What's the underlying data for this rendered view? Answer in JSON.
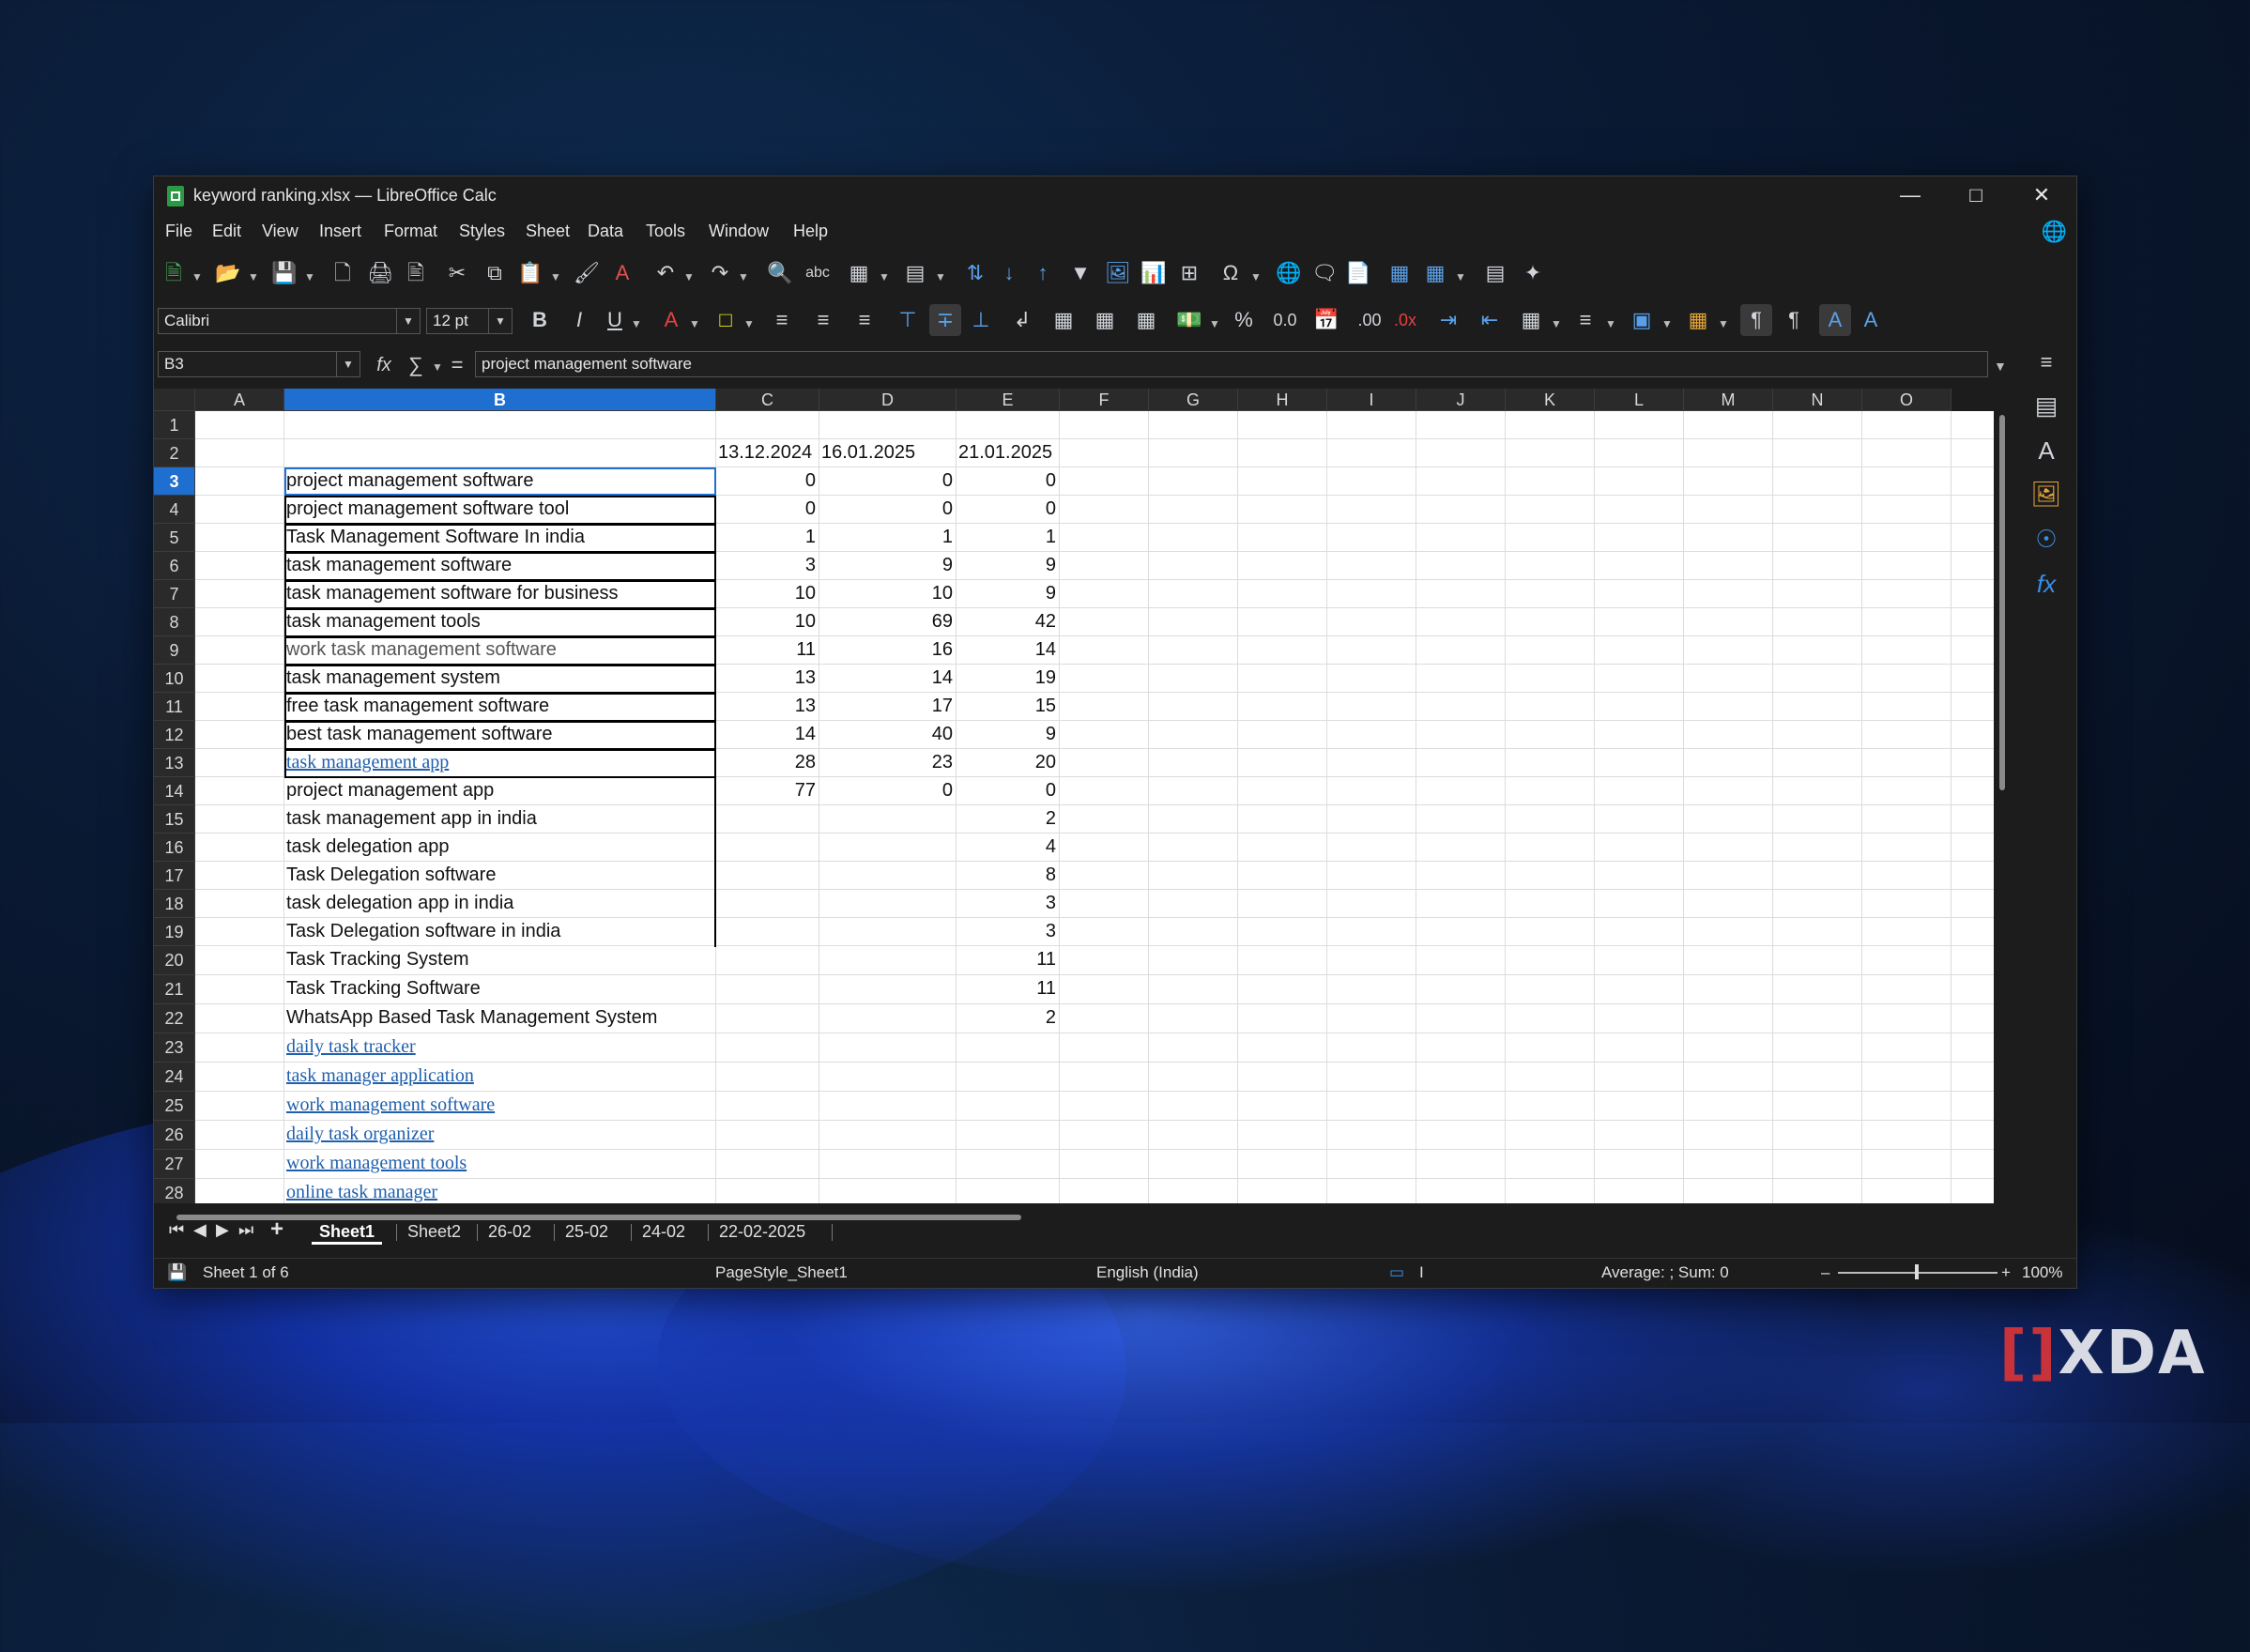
{
  "window": {
    "title": "keyword ranking.xlsx — LibreOffice Calc"
  },
  "menu": [
    "File",
    "Edit",
    "View",
    "Insert",
    "Format",
    "Styles",
    "Sheet",
    "Data",
    "Tools",
    "Window",
    "Help"
  ],
  "format": {
    "font_name": "Calibri",
    "font_size": "12 pt"
  },
  "formula_bar": {
    "cell_ref": "B3",
    "content": "project management software"
  },
  "columns": [
    "A",
    "B",
    "C",
    "D",
    "E",
    "F",
    "G",
    "H",
    "I",
    "J",
    "K",
    "L",
    "M",
    "N",
    "O"
  ],
  "rows": [
    "1",
    "2",
    "3",
    "4",
    "5",
    "6",
    "7",
    "8",
    "9",
    "10",
    "11",
    "12",
    "13",
    "14",
    "15",
    "16",
    "17",
    "18",
    "19",
    "20",
    "21",
    "22",
    "23",
    "24",
    "25",
    "26",
    "27",
    "28"
  ],
  "headers": {
    "c": "13.12.2024",
    "d": "16.01.2025",
    "e": "21.01.2025"
  },
  "data_rows": [
    {
      "keyword": "project management software",
      "c": "0",
      "d": "0",
      "e": "0"
    },
    {
      "keyword": "project management software tool",
      "c": "0",
      "d": "0",
      "e": "0"
    },
    {
      "keyword": "Task Management Software In india",
      "c": "1",
      "d": "1",
      "e": "1"
    },
    {
      "keyword": "task management software",
      "c": "3",
      "d": "9",
      "e": "9"
    },
    {
      "keyword": "task management software for business",
      "c": "10",
      "d": "10",
      "e": "9"
    },
    {
      "keyword": "task management tools",
      "c": "10",
      "d": "69",
      "e": "42"
    },
    {
      "keyword": "work task management software",
      "c": "11",
      "d": "16",
      "e": "14"
    },
    {
      "keyword": "task management system",
      "c": "13",
      "d": "14",
      "e": "19"
    },
    {
      "keyword": "free task management software",
      "c": "13",
      "d": "17",
      "e": "15"
    },
    {
      "keyword": "best task management software",
      "c": "14",
      "d": "40",
      "e": "9"
    },
    {
      "keyword": "task management app",
      "c": "28",
      "d": "23",
      "e": "20"
    },
    {
      "keyword": "project management app",
      "c": "77",
      "d": "0",
      "e": "0"
    },
    {
      "keyword": "task management app in india",
      "c": "",
      "d": "",
      "e": "2"
    },
    {
      "keyword": "task delegation app",
      "c": "",
      "d": "",
      "e": "4"
    },
    {
      "keyword": "Task Delegation software",
      "c": "",
      "d": "",
      "e": "8"
    },
    {
      "keyword": "task delegation app in india",
      "c": "",
      "d": "",
      "e": "3"
    },
    {
      "keyword": "Task Delegation software in india",
      "c": "",
      "d": "",
      "e": "3"
    },
    {
      "keyword": "Task Tracking System",
      "c": "",
      "d": "",
      "e": "11"
    },
    {
      "keyword": "Task Tracking Software",
      "c": "",
      "d": "",
      "e": "11"
    },
    {
      "keyword": "WhatsApp Based Task Management System",
      "c": "",
      "d": "",
      "e": "2"
    },
    {
      "keyword": "daily task tracker",
      "c": "",
      "d": "",
      "e": ""
    },
    {
      "keyword": "task manager application",
      "c": "",
      "d": "",
      "e": ""
    },
    {
      "keyword": "work management software",
      "c": "",
      "d": "",
      "e": ""
    },
    {
      "keyword": "daily task organizer",
      "c": "",
      "d": "",
      "e": ""
    },
    {
      "keyword": "work management tools",
      "c": "",
      "d": "",
      "e": ""
    },
    {
      "keyword": "online task manager",
      "c": "",
      "d": "",
      "e": ""
    }
  ],
  "sheet_tabs": [
    "Sheet1",
    "Sheet2",
    "26-02",
    "25-02",
    "24-02",
    "22-02-2025"
  ],
  "status": {
    "sheet_pos": "Sheet 1 of 6",
    "page_style": "PageStyle_Sheet1",
    "language": "English (India)",
    "summary": "Average: ; Sum: 0",
    "zoom": "100%"
  },
  "watermark": "XDA"
}
